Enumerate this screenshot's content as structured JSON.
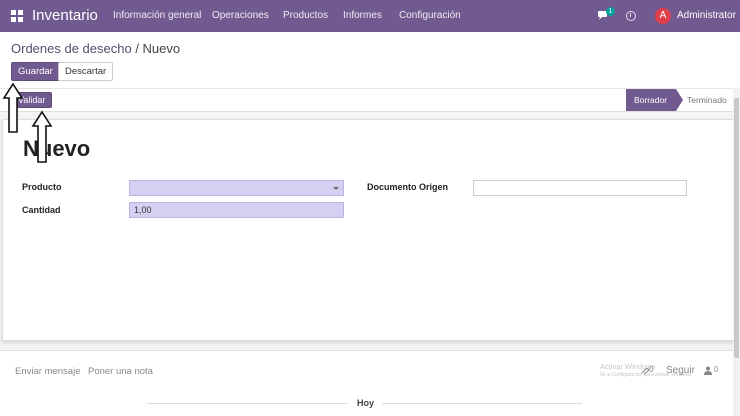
{
  "navbar": {
    "brand": "Inventario",
    "menu": [
      "Información general",
      "Operaciones",
      "Productos",
      "Informes",
      "Configuración"
    ],
    "notification_count": "1",
    "avatar_initial": "A",
    "user": "Administrator"
  },
  "breadcrumb": {
    "parent": "Ordenes de desecho",
    "separator": " / ",
    "current": "Nuevo"
  },
  "buttons": {
    "save": "Guardar",
    "discard": "Descartar",
    "validate": "Validar"
  },
  "status": {
    "active": "Borrador",
    "next": "Terminado"
  },
  "form": {
    "title": "Nuevo",
    "product_label": "Producto",
    "product_value": "",
    "quantity_label": "Cantidad",
    "quantity_value": "1,00",
    "origin_label": "Documento Origen",
    "origin_value": ""
  },
  "chatter": {
    "send_message": "Enviar mensaje",
    "log_note": "Poner una nota",
    "watermark_line1": "Activar Windows",
    "watermark_line2": "Ve a Configuración para activar Windows.",
    "followers_count": "0",
    "follow": "Seguir",
    "people_count": "0",
    "today": "Hoy"
  },
  "colors": {
    "brand": "#715a8f",
    "field_highlight": "#d3d0f2",
    "avatar": "#e0404c"
  }
}
